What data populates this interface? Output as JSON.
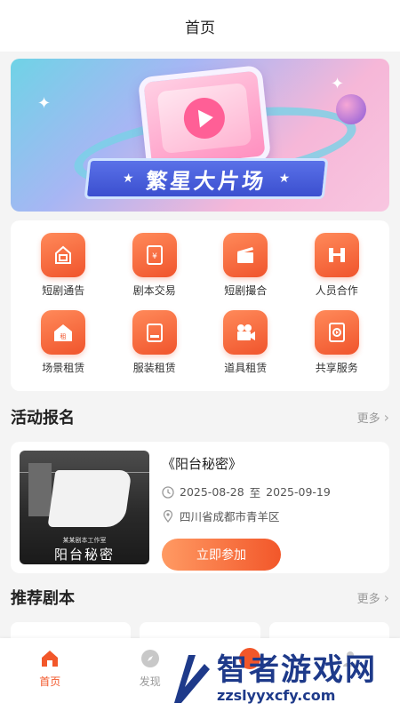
{
  "header": {
    "title": "首页"
  },
  "banner": {
    "title": "繁星大片场"
  },
  "grid": {
    "items": [
      {
        "label": "短剧通告",
        "icon": "notice-icon"
      },
      {
        "label": "剧本交易",
        "icon": "script-trade-icon"
      },
      {
        "label": "短剧撮合",
        "icon": "clapperboard-icon"
      },
      {
        "label": "人员合作",
        "icon": "cooperation-icon"
      },
      {
        "label": "场景租赁",
        "icon": "house-icon"
      },
      {
        "label": "服装租赁",
        "icon": "costume-icon"
      },
      {
        "label": "道具租赁",
        "icon": "camera-icon"
      },
      {
        "label": "共享服务",
        "icon": "share-service-icon"
      }
    ]
  },
  "activity": {
    "section_title": "活动报名",
    "more": "更多",
    "item": {
      "title": "《阳台秘密》",
      "date_start": "2025-08-28",
      "date_sep": "至",
      "date_end": "2025-09-19",
      "location": "四川省成都市青羊区",
      "poster_title": "阳台秘密",
      "poster_subtitle": "某某剧本工作室",
      "join_label": "立即参加"
    }
  },
  "scripts": {
    "section_title": "推荐剧本",
    "more": "更多"
  },
  "tabbar": {
    "items": [
      {
        "label": "首页",
        "icon": "home-icon",
        "active": true
      },
      {
        "label": "发现",
        "icon": "compass-icon",
        "active": false
      },
      {
        "label": "",
        "icon": "center-icon",
        "active": false
      },
      {
        "label": "",
        "icon": "user-icon",
        "active": false
      }
    ]
  },
  "watermark": {
    "main": "智者游戏网",
    "sub": "zzslyyxcfy.com"
  },
  "colors": {
    "accent": "#f2572a",
    "accent_light": "#ff8a5a",
    "banner_ribbon": "#3b4fcf"
  }
}
